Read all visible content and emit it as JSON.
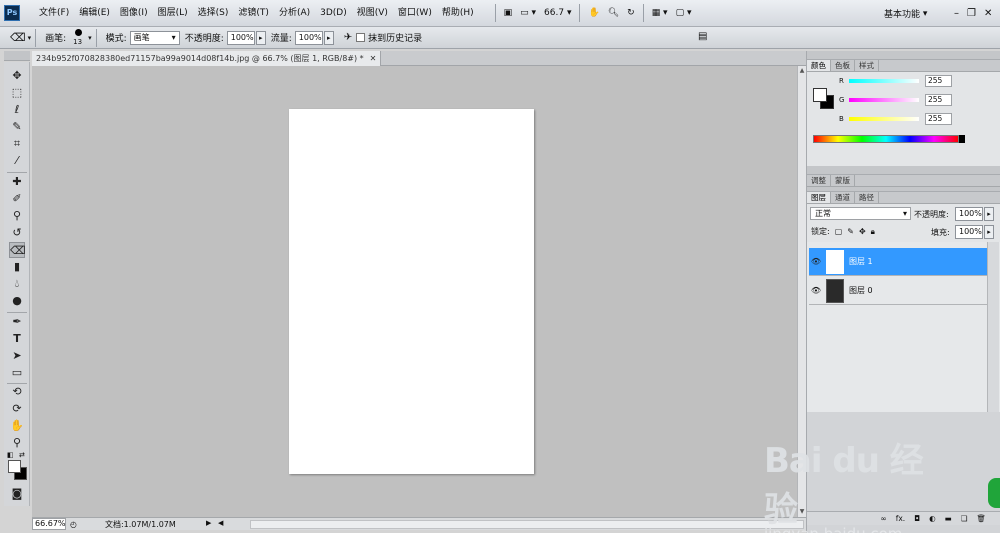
{
  "app": {
    "logo": "Ps"
  },
  "menu": [
    "文件(F)",
    "编辑(E)",
    "图像(I)",
    "图层(L)",
    "选择(S)",
    "滤镜(T)",
    "分析(A)",
    "3D(D)",
    "视图(V)",
    "窗口(W)",
    "帮助(H)"
  ],
  "appbar": {
    "zoom": "66.7",
    "workspace": "基本功能"
  },
  "options": {
    "brush_label": "画笔:",
    "brush_size": "13",
    "mode_label": "模式:",
    "mode_value": "画笔",
    "opacity_label": "不透明度:",
    "opacity_value": "100%",
    "flow_label": "流量:",
    "flow_value": "100%",
    "erase_history_label": "抹到历史记录"
  },
  "document": {
    "tab_title": "234b952f070828380ed71157ba99a9014d08f14b.jpg @ 66.7% (图层 1, RGB/8#) *"
  },
  "status": {
    "zoom": "66.67%",
    "doc_info": "文档:1.07M/1.07M"
  },
  "color_panel": {
    "tabs": [
      "颜色",
      "色板",
      "样式"
    ],
    "r_label": "R",
    "r_value": "255",
    "g_label": "G",
    "g_value": "255",
    "b_label": "B",
    "b_value": "255"
  },
  "adjust_panel": {
    "tabs": [
      "调整",
      "蒙版"
    ]
  },
  "layers_panel": {
    "tabs": [
      "图层",
      "通道",
      "路径"
    ],
    "blend_mode": "正常",
    "opacity_label": "不透明度:",
    "opacity_value": "100%",
    "lock_label": "锁定:",
    "fill_label": "填充:",
    "fill_value": "100%",
    "layers": [
      {
        "name": "图层 1",
        "selected": true
      },
      {
        "name": "图层 0",
        "selected": false
      }
    ]
  },
  "watermark": {
    "brand": "Bai du 经验",
    "url": "jingyan.baidu.com"
  },
  "colors": {
    "selection": "#3399ff",
    "canvas_bg": "#c0c0c0",
    "ps_blue": "#0b2c4f"
  }
}
